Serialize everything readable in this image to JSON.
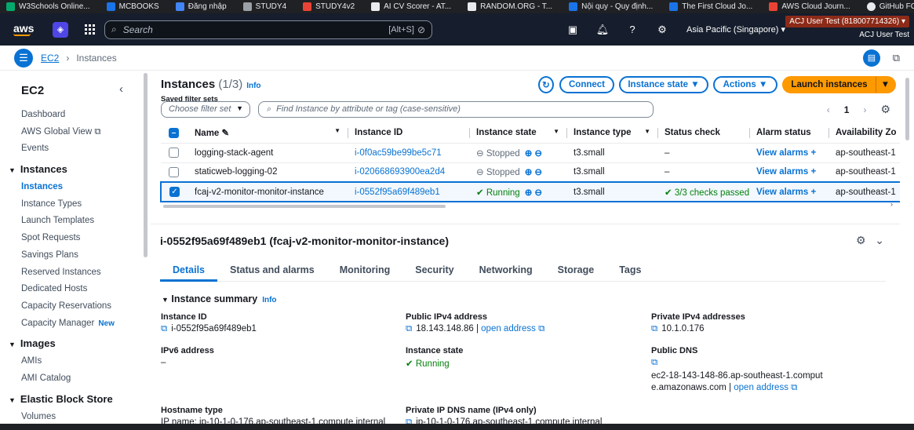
{
  "bookmarks": [
    {
      "label": "W3Schools Online...",
      "color": "#04aa6d",
      "icon": "w3schools-icon"
    },
    {
      "label": "MCBOOKS",
      "color": "#1a73e8",
      "icon": "mcbooks-icon"
    },
    {
      "label": "Đăng nhập",
      "color": "#4285f4",
      "icon": "login-icon"
    },
    {
      "label": "STUDY4",
      "color": "#9aa0a6",
      "icon": "study4-icon"
    },
    {
      "label": "STUDY4v2",
      "color": "#ea4335",
      "icon": "study4v2-icon"
    },
    {
      "label": "AI CV Scorer - AT...",
      "color": "#e8eaed",
      "icon": "ai-cv-icon"
    },
    {
      "label": "RANDOM.ORG - T...",
      "color": "#e8eaed",
      "icon": "random-org-icon"
    },
    {
      "label": "Nội quy - Quy định...",
      "color": "#1a73e8",
      "icon": "rules-icon"
    },
    {
      "label": "The First Cloud Jo...",
      "color": "#1a73e8",
      "icon": "cloud-journey-icon"
    },
    {
      "label": "AWS Cloud Journ...",
      "color": "#ea4335",
      "icon": "aws-journey-icon"
    },
    {
      "label": "GitHub FCAJ",
      "color": "#e8eaed",
      "icon": "github-icon"
    }
  ],
  "topnav": {
    "logo": "aws",
    "search_placeholder": "Search",
    "search_hotkey": "[Alt+S]",
    "region": "Asia Pacific (Singapore)",
    "account": "ACJ User Test (818007714326)",
    "user": "ACJ User Test"
  },
  "breadcrumb": {
    "parent": "EC2",
    "current": "Instances"
  },
  "sidebar": {
    "title": "EC2",
    "items_top": [
      "Dashboard",
      "AWS Global View",
      "Events"
    ],
    "sec_instances": "Instances",
    "instances": [
      "Instances",
      "Instance Types",
      "Launch Templates",
      "Spot Requests",
      "Savings Plans",
      "Reserved Instances",
      "Dedicated Hosts",
      "Capacity Reservations",
      "Capacity Manager"
    ],
    "new_badge": "New",
    "sec_images": "Images",
    "images": [
      "AMIs",
      "AMI Catalog"
    ],
    "sec_ebs": "Elastic Block Store",
    "ebs": [
      "Volumes"
    ]
  },
  "header": {
    "title": "Instances",
    "count": "(1/3)",
    "info": "Info",
    "connect": "Connect",
    "instance_state": "Instance state",
    "actions": "Actions",
    "launch": "Launch instances"
  },
  "filter": {
    "saved_label": "Saved filter sets",
    "saved_placeholder": "Choose filter set",
    "find_placeholder": "Find Instance by attribute or tag (case-sensitive)",
    "page": "1"
  },
  "table": {
    "columns": [
      "Name",
      "Instance ID",
      "Instance state",
      "Instance type",
      "Status check",
      "Alarm status",
      "Availability Zo"
    ],
    "rows": [
      {
        "name": "logging-stack-agent",
        "id": "i-0f0ac59be99be5c71",
        "state": "Stopped",
        "type": "t3.small",
        "status": "–",
        "alarm": "View alarms",
        "az": "ap-southeast-1",
        "selected": false
      },
      {
        "name": "staticweb-logging-02",
        "id": "i-020668693900ea2d4",
        "state": "Stopped",
        "type": "t3.small",
        "status": "–",
        "alarm": "View alarms",
        "az": "ap-southeast-1",
        "selected": false
      },
      {
        "name": "fcaj-v2-monitor-monitor-instance",
        "id": "i-0552f95a69f489eb1",
        "state": "Running",
        "type": "t3.small",
        "status": "3/3 checks passed",
        "alarm": "View alarms",
        "az": "ap-southeast-1",
        "selected": true
      }
    ]
  },
  "details": {
    "heading": "i-0552f95a69f489eb1 (fcaj-v2-monitor-monitor-instance)",
    "tabs": [
      "Details",
      "Status and alarms",
      "Monitoring",
      "Security",
      "Networking",
      "Storage",
      "Tags"
    ],
    "summary": "Instance summary",
    "info": "Info",
    "instance_id_label": "Instance ID",
    "instance_id": "i-0552f95a69f489eb1",
    "public_ipv4_label": "Public IPv4 address",
    "public_ipv4": "18.143.148.86",
    "open_address": "open address",
    "private_ipv4_label": "Private IPv4 addresses",
    "private_ipv4": "10.1.0.176",
    "ipv6_label": "IPv6 address",
    "ipv6": "–",
    "state_label": "Instance state",
    "state": "Running",
    "public_dns_label": "Public DNS",
    "public_dns": "ec2-18-143-148-86.ap-southeast-1.compute.amazonaws.com",
    "hostname_label": "Hostname type",
    "hostname": "IP name: ip-10-1-0-176.ap-southeast-1.compute.internal",
    "private_dns_label": "Private IP DNS name (IPv4 only)",
    "private_dns": "ip-10-1-0-176.ap-southeast-1.compute.internal"
  }
}
